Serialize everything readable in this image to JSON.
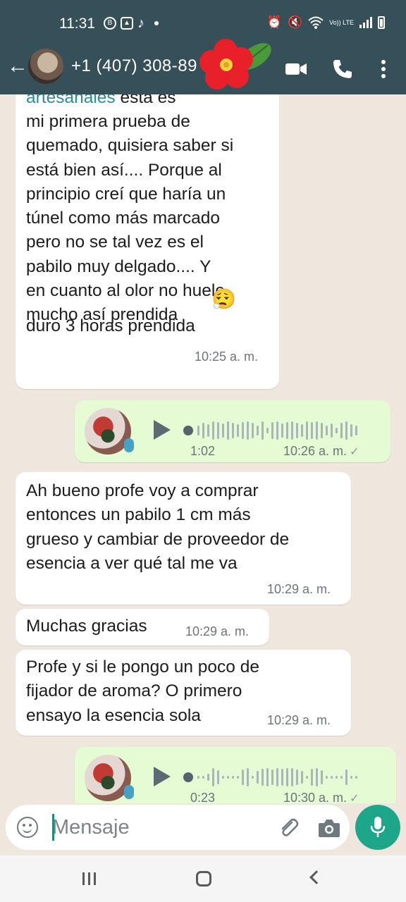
{
  "status_bar": {
    "time": "11:31",
    "left_icons": [
      "b-icon",
      "gallery-icon",
      "tiktok-icon"
    ],
    "network": "Vo)) LTE",
    "right_icons": [
      "alarm-icon",
      "mute-icon",
      "wifi-icon",
      "signal-icon",
      "battery-icon"
    ]
  },
  "header": {
    "contact_name": "+1 (407) 308-89",
    "icons": [
      "back-arrow-icon",
      "video-call-icon",
      "phone-icon",
      "more-options-icon"
    ],
    "colors": {
      "bar": "#36505a"
    }
  },
  "messages": [
    {
      "direction": "incoming",
      "link_text": "artesanales",
      "text_after_link": " esta es",
      "text": "mi primera prueba de\nquemado, quisiera saber si\nestá bien así.... Porque al\nprincipio creí que haría un\ntúnel como más marcado\npero no se tal vez es el\npabilo muy delgado.... Y\nen cuanto al olor no huele\nmucho así prendida",
      "emoji": "😮‍💨",
      "text_last": "duro 3 horas prendida",
      "time": "10:25 a. m."
    },
    {
      "direction": "outgoing",
      "type": "voice",
      "duration": "1:02",
      "time": "10:26 a. m.",
      "status": "✓"
    },
    {
      "direction": "incoming",
      "text": "Ah bueno profe voy a comprar\nentonces un pabilo 1 cm más\ngrueso y cambiar de proveedor de\nesencia a ver qué tal me va",
      "time": "10:29 a. m."
    },
    {
      "direction": "incoming",
      "text": "Muchas gracias",
      "time": "10:29 a. m."
    },
    {
      "direction": "incoming",
      "text": "Profe y si le pongo un poco de\nfijador de aroma? O primero\nensayo la esencia sola",
      "time": "10:29 a. m."
    },
    {
      "direction": "outgoing",
      "type": "voice",
      "duration": "0:23",
      "time": "10:30 a. m.",
      "status": "✓"
    }
  ],
  "input": {
    "placeholder": "Mensaje",
    "icons": [
      "emoji-icon",
      "attach-icon",
      "camera-icon",
      "mic-icon"
    ]
  },
  "navigation": {
    "icons": [
      "recents-icon",
      "home-icon",
      "back-icon"
    ]
  },
  "colors": {
    "chat_bg": "#efe7de",
    "outgoing_bubble": "#e4fbd3",
    "incoming_bubble": "#ffffff",
    "accent": "#1da689"
  }
}
